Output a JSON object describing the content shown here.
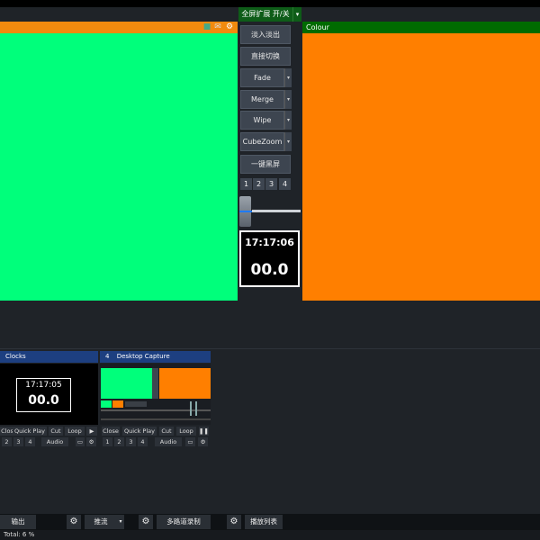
{
  "colors": {
    "preview_bg": "#00ff7b",
    "output_bg": "#ff7f00",
    "preview_header": "#f28a0e",
    "output_header": "#006b00",
    "input_header": "#1d3f80"
  },
  "header": {
    "fullscreen_label": "全屏扩展 开/关",
    "fullscreen_arrow": "▾"
  },
  "preview": {
    "icons": [
      "■",
      "✉",
      "⚙"
    ]
  },
  "output": {
    "title": "Colour"
  },
  "transitions": {
    "buttons": [
      "淡入淡出",
      "直接切换",
      "Fade",
      "Merge",
      "Wipe",
      "CubeZoom",
      "一键黑屏"
    ],
    "arrow": "▾",
    "numbers": [
      "1",
      "2",
      "3",
      "4"
    ]
  },
  "clock": {
    "time": "17:17:06",
    "countdown": "00.0"
  },
  "inputs": [
    {
      "number": "",
      "title": "Clocks",
      "time": "17:17:05",
      "countdown": "00.0",
      "controls": [
        "Close",
        "Quick Play",
        "Cut",
        "Loop",
        "▶"
      ],
      "row2": [
        "2",
        "3",
        "4",
        "Audio",
        "▭",
        "⚙"
      ]
    },
    {
      "number": "4",
      "title": "Desktop Capture",
      "controls": [
        "Close",
        "Quick Play",
        "Cut",
        "Loop",
        "❚❚"
      ],
      "row2": [
        "1",
        "2",
        "3",
        "4",
        "Audio",
        "▭",
        "⚙"
      ]
    }
  ],
  "bottom": {
    "output": "输出",
    "gear": "⚙",
    "stream": "推流",
    "stream_arrow": "▾",
    "multi_record": "多路道录制",
    "playlist": "播放列表"
  },
  "status": {
    "text": "Total: 6 %"
  }
}
